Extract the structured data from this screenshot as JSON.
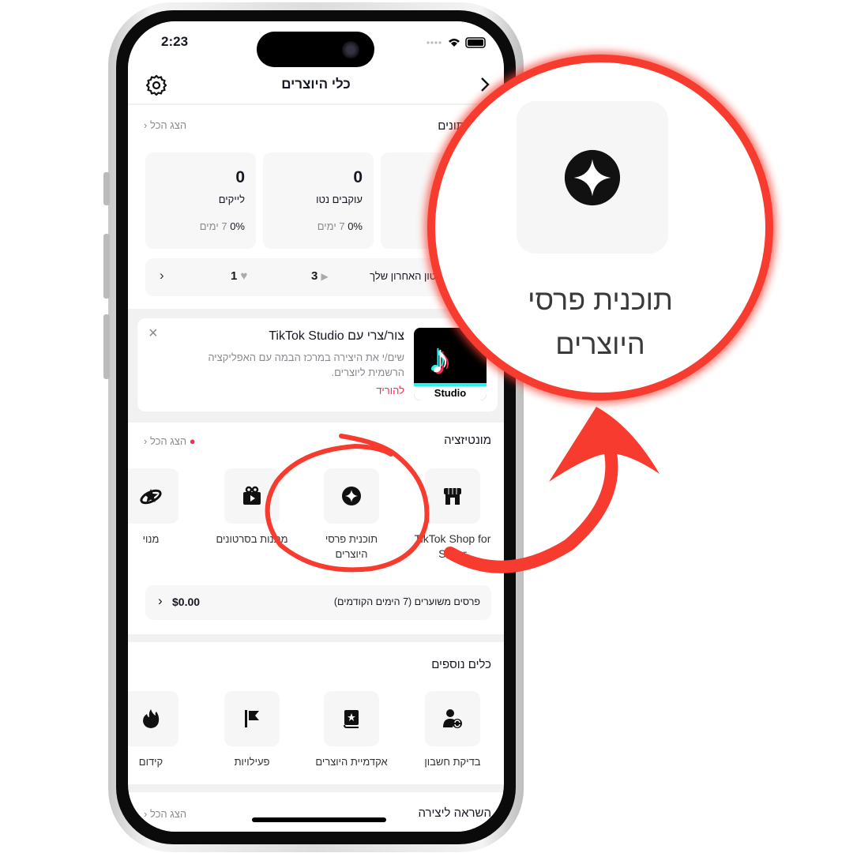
{
  "status": {
    "time": "2:23"
  },
  "header": {
    "title": "כלי היוצרים",
    "settings_icon": "gear-icon",
    "back_icon": "chevron-right-icon"
  },
  "analytics": {
    "title": "נתונים",
    "see_all": "הצג הכל",
    "cards": [
      {
        "value": "0",
        "label": "לייקים",
        "change": "0%",
        "period": "7 ימים"
      },
      {
        "value": "0",
        "label": "עוקבים נטו",
        "change": "0%",
        "period": "7 ימים"
      }
    ],
    "latest": {
      "label": "הסרטון האחרון שלך",
      "views": "3",
      "likes": "1"
    }
  },
  "promo": {
    "title": "צור/צרי עם TikTok Studio",
    "body": "שים/י את היצירה במרכז הבמה עם האפליקציה הרשמית ליוצרים.",
    "link": "להוריד",
    "logo_text": "Studio",
    "link_color": "#fe2c55"
  },
  "monetization": {
    "title": "מונטיזציה",
    "see_all": "הצג הכל",
    "items": [
      {
        "label": "TikTok Shop for Seller",
        "icon": "shop-icon"
      },
      {
        "label": "תוכנית פרסי היוצרים",
        "icon": "sparkle-icon"
      },
      {
        "label": "מתנות בסרטונים",
        "icon": "gift-icon"
      },
      {
        "label": "מנוי",
        "icon": "planet-star-icon"
      }
    ],
    "estimate_label": "פרסים משוערים (7 הימים הקודמים)",
    "estimate_value": "$0.00"
  },
  "tools": {
    "title": "כלים נוספים",
    "items": [
      {
        "label": "בדיקת חשבון",
        "icon": "user-refresh-icon"
      },
      {
        "label": "אקדמיית היוצרים",
        "icon": "book-star-icon"
      },
      {
        "label": "פעילויות",
        "icon": "flag-icon"
      },
      {
        "label": "קידום",
        "icon": "flame-icon"
      }
    ]
  },
  "inspiration": {
    "title": "השראה ליצירה",
    "see_all": "הצג הכל"
  },
  "callout": {
    "label_line1": "תוכנית פרסי",
    "label_line2": "היוצרים",
    "icon": "sparkle-icon",
    "color": "#f73b2f"
  }
}
